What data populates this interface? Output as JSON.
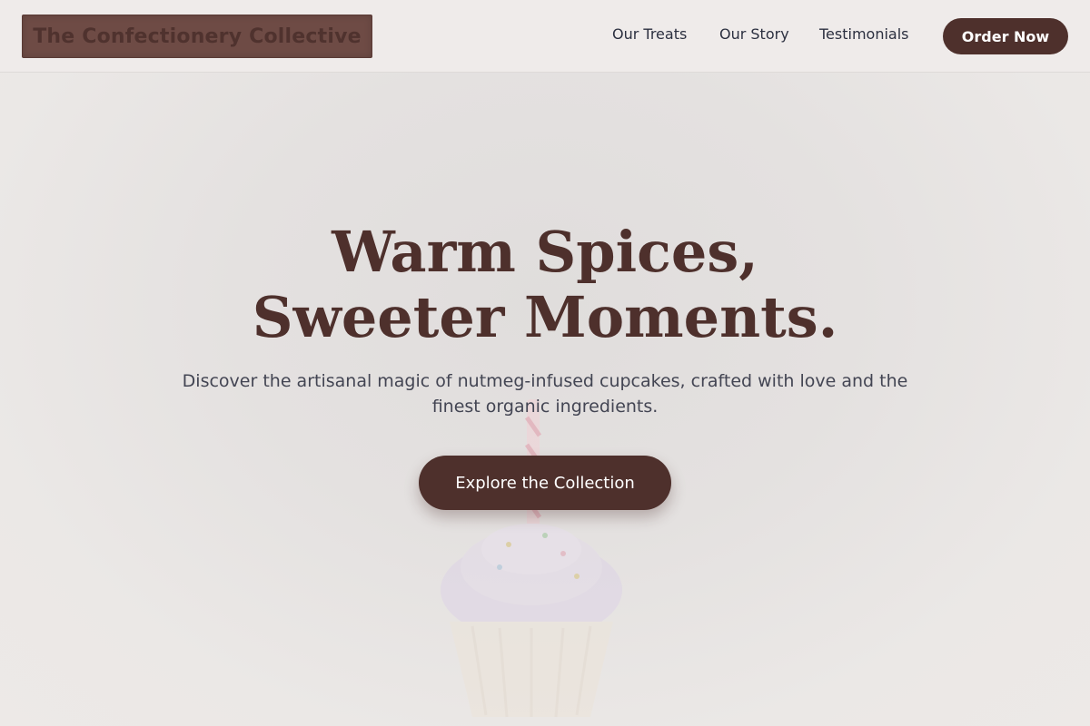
{
  "header": {
    "brand": "The Confectionery Collective",
    "nav": [
      {
        "label": "Our Treats"
      },
      {
        "label": "Our Story"
      },
      {
        "label": "Testimonials"
      }
    ],
    "order_label": "Order Now"
  },
  "hero": {
    "title_line1": "Warm Spices,",
    "title_line2": "Sweeter Moments.",
    "subtitle": "Discover the artisanal magic of nutmeg-infused cupcakes, crafted with love and the finest organic ingredients.",
    "cta_label": "Explore the Collection",
    "background_image": "cupcake-with-candle"
  },
  "colors": {
    "brand_brown": "#4e302c",
    "header_bg": "#efebea",
    "hero_bg": "#e6e3e2",
    "text_dark": "#2c3040"
  }
}
